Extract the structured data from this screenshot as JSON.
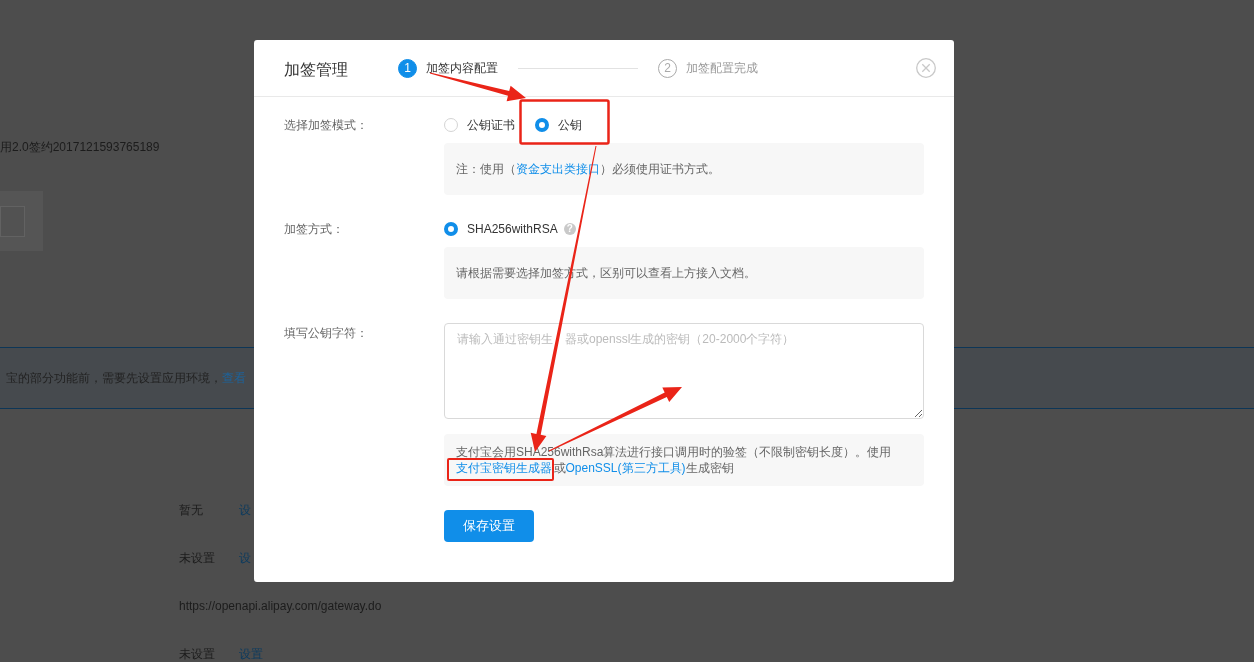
{
  "background_page": {
    "app_caption": "用2.0签约2017121593765189",
    "notice": {
      "text": "宝的部分功能前，需要先设置应用环境，",
      "link": "查看"
    },
    "settings_rows": [
      {
        "value": "暂无",
        "link": "设"
      },
      {
        "value": "未设置",
        "link": "设"
      },
      {
        "value": "https://openapi.alipay.com/gateway.do"
      },
      {
        "value": "未设置",
        "link": "设置"
      }
    ]
  },
  "dialog": {
    "title": "加签管理",
    "steps": [
      {
        "number": "1",
        "label": "加签内容配置",
        "selected": true
      },
      {
        "number": "2",
        "label": "加签配置完成",
        "selected": false
      }
    ],
    "form": [
      {
        "kind": "radio",
        "label": "选择加签模式：",
        "options": [
          {
            "label": "公钥证书",
            "selected": false
          },
          {
            "label": "公钥",
            "selected": true
          }
        ],
        "note": [
          {
            "kind": "text",
            "text": "注：使用（"
          },
          {
            "kind": "link",
            "text": "资金支出类接口",
            "highlighted": false
          },
          {
            "kind": "text",
            "text": "）必须使用证书方式。"
          }
        ]
      },
      {
        "kind": "radio",
        "label": "加签方式：",
        "options": [
          {
            "label": "SHA256withRSA",
            "selected": true,
            "help": "?"
          }
        ],
        "note": [
          {
            "kind": "text",
            "text": "请根据需要选择加签方式，区别可以查看上方接入文档。"
          }
        ]
      },
      {
        "kind": "textarea",
        "label": "填写公钥字符：",
        "placeholder": "请输入通过密钥生　器或openssl生成的密钥（20-2000个字符）",
        "note": [
          {
            "kind": "text",
            "text": "支付宝会用SHA256withRsa算法进行接口调用时的验签（不限制密钥长度）。使用"
          },
          {
            "kind": "link",
            "text": "支付宝密钥生成器",
            "highlighted": true
          },
          {
            "kind": "text",
            "text": "或"
          },
          {
            "kind": "link",
            "text": "OpenSSL(第三方工具)",
            "highlighted": false
          },
          {
            "kind": "text",
            "text": "生成密钥"
          }
        ]
      }
    ],
    "save_button": "保存设置"
  },
  "annotations": [
    {
      "kind": "arrow"
    },
    {
      "kind": "frame"
    },
    {
      "kind": "arrow"
    },
    {
      "kind": "arrow"
    }
  ]
}
